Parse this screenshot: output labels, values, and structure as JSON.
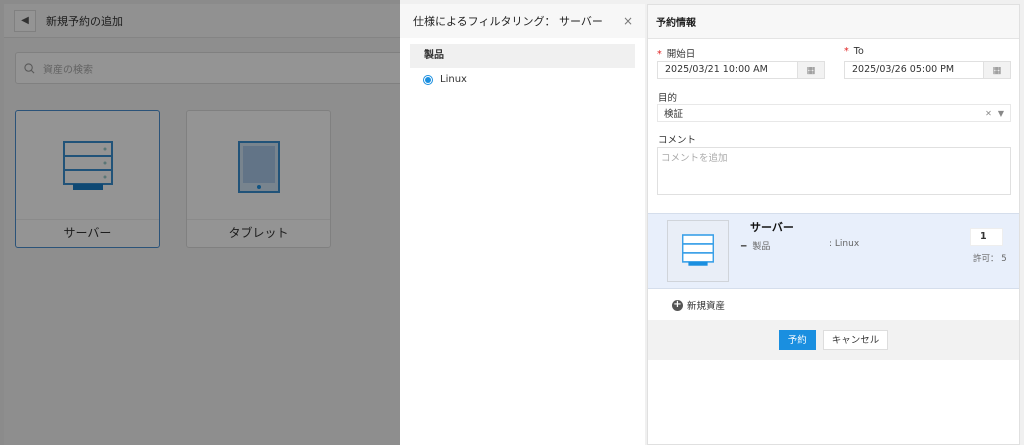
{
  "background_page": {
    "title": "新規予約の追加",
    "search_placeholder": "資産の検索",
    "categories": [
      {
        "label": "サーバー",
        "selected": true
      },
      {
        "label": "タブレット",
        "selected": false
      }
    ]
  },
  "filter_panel": {
    "title": "仕様によるフィルタリング： サーバー",
    "close": "×",
    "section": "製品",
    "options": [
      {
        "label": "Linux",
        "selected": true
      }
    ]
  },
  "reservation": {
    "title": "予約情報",
    "start_label": "開始日",
    "start_value": "2025/03/21 10:00 AM",
    "end_label": "To",
    "end_value": "2025/03/26 05:00 PM",
    "purpose_label": "目的",
    "purpose_value": "検証",
    "comment_label": "コメント",
    "comment_placeholder": "コメントを追加",
    "item": {
      "name": "サーバー",
      "spec_label": "製品",
      "spec_value": ": Linux",
      "quantity": "1",
      "allowed": "許可： 5"
    },
    "add_asset": "新規資産",
    "reserve_button": "予約",
    "cancel_button": "キャンセル",
    "required_mark": "*"
  },
  "colors": {
    "accent": "#1a8fe0",
    "required": "#e02020",
    "item_bg": "#e8effb"
  }
}
